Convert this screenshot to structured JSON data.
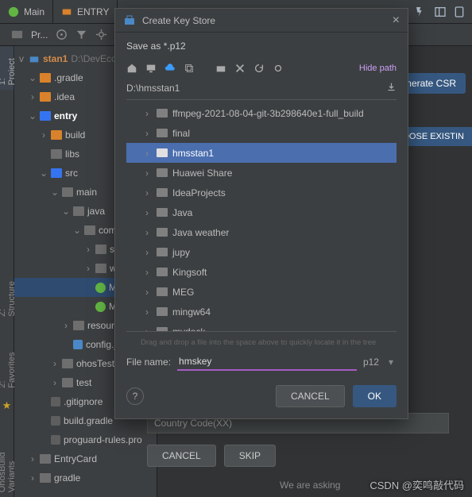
{
  "top_tabs": [
    "Main",
    "ENTRY"
  ],
  "toolrow": {
    "project_label": "Pr..."
  },
  "project_tree": {
    "root_name": "stan1",
    "root_path": "D:\\DevEcoStu",
    "items": [
      {
        "depth": 1,
        "chev": "v",
        "color": "orange",
        "label": ".gradle"
      },
      {
        "depth": 1,
        "chev": ">",
        "color": "orange",
        "label": ".idea"
      },
      {
        "depth": 1,
        "chev": "v",
        "color": "blue",
        "label": "entry",
        "highlight": true
      },
      {
        "depth": 2,
        "chev": ">",
        "color": "orange",
        "label": "build"
      },
      {
        "depth": 2,
        "chev": "",
        "color": "grey",
        "label": "libs"
      },
      {
        "depth": 2,
        "chev": "v",
        "color": "blue",
        "label": "src"
      },
      {
        "depth": 3,
        "chev": "v",
        "color": "grey",
        "label": "main"
      },
      {
        "depth": 4,
        "chev": "v",
        "color": "grey",
        "label": "java"
      },
      {
        "depth": 5,
        "chev": "v",
        "color": "grey",
        "label": "com.l"
      },
      {
        "depth": 6,
        "chev": ">",
        "color": "grey",
        "label": "sli"
      },
      {
        "depth": 6,
        "chev": ">",
        "color": "grey",
        "label": "wi"
      },
      {
        "depth": 6,
        "chev": "",
        "icon": "c",
        "label": "M",
        "selected": true
      },
      {
        "depth": 6,
        "chev": "",
        "icon": "c",
        "label": "M"
      },
      {
        "depth": 4,
        "chev": ">",
        "color": "grey",
        "label": "resource"
      },
      {
        "depth": 4,
        "chev": "",
        "icon": "leaf-blue",
        "label": "config.js"
      },
      {
        "depth": 3,
        "chev": ">",
        "color": "grey",
        "label": "ohosTest"
      },
      {
        "depth": 3,
        "chev": ">",
        "color": "grey",
        "label": "test"
      },
      {
        "depth": 2,
        "chev": "",
        "icon": "leaf-dim",
        "label": ".gitignore"
      },
      {
        "depth": 2,
        "chev": "",
        "icon": "leaf-dim",
        "label": "build.gradle"
      },
      {
        "depth": 2,
        "chev": "",
        "icon": "leaf-dim",
        "label": "proguard-rules.pro"
      },
      {
        "depth": 1,
        "chev": ">",
        "color": "grey",
        "label": "EntryCard"
      },
      {
        "depth": 1,
        "chev": ">",
        "color": "grey",
        "label": "gradle"
      }
    ]
  },
  "gutter_top": "1: Project",
  "gutter_items": [
    "Z: Structure",
    "2: Favorites",
    "OhosBuild Variants"
  ],
  "right_buttons": {
    "generate_csr": "enerate CSR",
    "choose_existing": "HOOSE EXISTIN"
  },
  "dialog": {
    "title": "Create Key Store",
    "save_as": "Save as *.p12",
    "hide_path": "Hide path",
    "current_path": "D:\\hmsstan1",
    "folders": [
      "ffmpeg-2021-08-04-git-3b298640e1-full_build",
      "final",
      "hmsstan1",
      "Huawei Share",
      "IdeaProjects",
      "Java",
      "Java weather",
      "jupy",
      "Kingsoft",
      "MEG",
      "mingw64",
      "mydock"
    ],
    "selected_index": 2,
    "drag_hint": "Drag and drop a file into the space above to quickly locate it in the tree",
    "file_name_label": "File name:",
    "file_name_value": "hmskey",
    "ext": "p12",
    "cancel": "CANCEL",
    "ok": "OK"
  },
  "wizard": {
    "country_code": "Country Code(XX)",
    "cancel": "CANCEL",
    "skip": "SKIP"
  },
  "bottom_text": "We are asking ",
  "watermark": "CSDN @奕鸣敲代码"
}
